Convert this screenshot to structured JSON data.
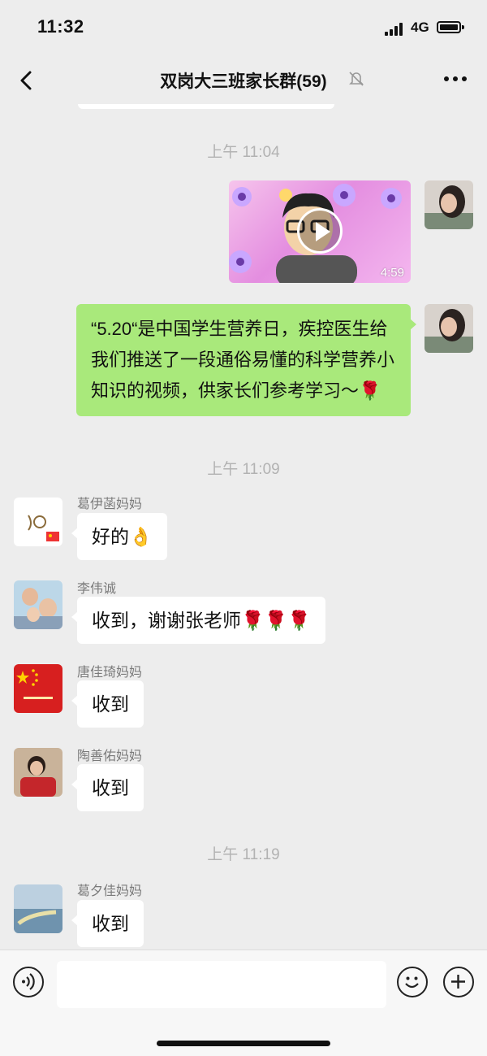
{
  "status": {
    "time": "11:32",
    "network": "4G"
  },
  "nav": {
    "title": "双岗大三班家长群(59)",
    "back_icon": "chevron-left-icon",
    "mute_icon": "bell-slash-icon",
    "more_icon": "ellipsis-icon"
  },
  "timestamps": [
    "上午 11:04",
    "上午 11:09",
    "上午 11:19"
  ],
  "video": {
    "duration": "4:59"
  },
  "self_message": {
    "text": "“5.20“是中国学生营养日，疾控医生给我们推送了一段通俗易懂的科学营养小知识的视频，供家长们参考学习～🌹"
  },
  "messages": [
    {
      "sender": "葛伊菡妈妈",
      "text": "好的👌"
    },
    {
      "sender": "李伟诚",
      "text": "收到，谢谢张老师🌹🌹🌹"
    },
    {
      "sender": "唐佳琦妈妈",
      "text": "收到"
    },
    {
      "sender": "陶善佑妈妈",
      "text": "收到"
    },
    {
      "sender": "葛夕佳妈妈",
      "text": "收到"
    }
  ],
  "input": {
    "placeholder": "",
    "voice_icon": "voice-icon",
    "emoji_icon": "emoji-icon",
    "plus_icon": "plus-icon"
  }
}
